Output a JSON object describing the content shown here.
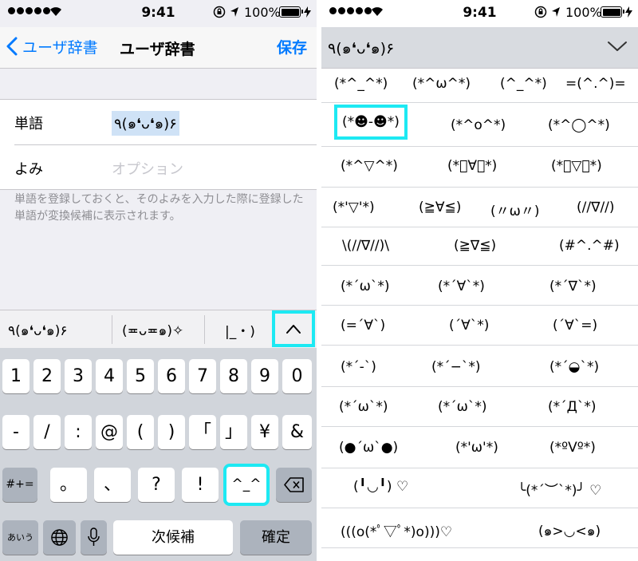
{
  "status": {
    "time": "9:41",
    "battery": "100%"
  },
  "nav": {
    "back_label": "ユーザ辞書",
    "title": "ユーザ辞書",
    "save_label": "保存"
  },
  "form": {
    "word_label": "単語",
    "word_value": "٩(๑❛ᴗ❛๑)۶",
    "reading_label": "よみ",
    "reading_placeholder": "オプション"
  },
  "hint": "単語を登録しておくと、そのよみを入力した際に登録した単語が変換候補に表示されます。",
  "candidates": [
    "٩(๑❛ᴗ❛๑)۶",
    "(≖ᴗ≖๑)✧",
    "|_・)"
  ],
  "keyboard": {
    "row1": [
      "1",
      "2",
      "3",
      "4",
      "5",
      "6",
      "7",
      "8",
      "9",
      "0"
    ],
    "row2": [
      "-",
      "/",
      ":",
      "@",
      "(",
      ")",
      "「",
      "」",
      "¥",
      "&"
    ],
    "row3_left": "#+=",
    "row3": [
      "。",
      "、",
      "?",
      "!",
      "^_^"
    ],
    "mode_label": "あいう",
    "next_candidate": "次候補",
    "confirm": "確定"
  },
  "expanded": {
    "current": "٩(๑❛ᴗ❛๑)۶",
    "rows": [
      [
        "(*^_^*)",
        "(*^ω^*)",
        "(^_^*)",
        "=(^.^)="
      ],
      [
        "(*☻-☻*)",
        "(*^o^*)",
        "(*^◯^*)"
      ],
      [
        "(*^▽^*)",
        "(*ﾟ∀ﾟ*)",
        "(*ﾟ▽ﾟ*)"
      ],
      [
        "(*'▽'*)",
        "(≧∀≦)",
        "(〃ω〃)",
        "(//∇//)"
      ],
      [
        "\\(//∇//)\\",
        "(≧∇≦)",
        "(#^.^#)"
      ],
      [
        "(*´ω`*)",
        "(*´∀`*)",
        "(*´∇`*)"
      ],
      [
        "(=´∀`)",
        "(´∀`*)",
        "(´∀`=)"
      ],
      [
        "(*´-`)",
        "(*´−`*)",
        "(*´◒`*)"
      ],
      [
        "(*´ω`*)",
        "(*´ω`*)",
        "(*´Д`*)"
      ],
      [
        "(●´ω`●)",
        "(*'ω'*)",
        "(*ºVº*)"
      ],
      [
        "(╹◡╹) ♡",
        "╰(*´︶`*)╯ ♡"
      ],
      [
        "(((o(*ﾟ▽ﾟ*)o)))♡",
        "(๑>◡<๑)"
      ]
    ]
  }
}
